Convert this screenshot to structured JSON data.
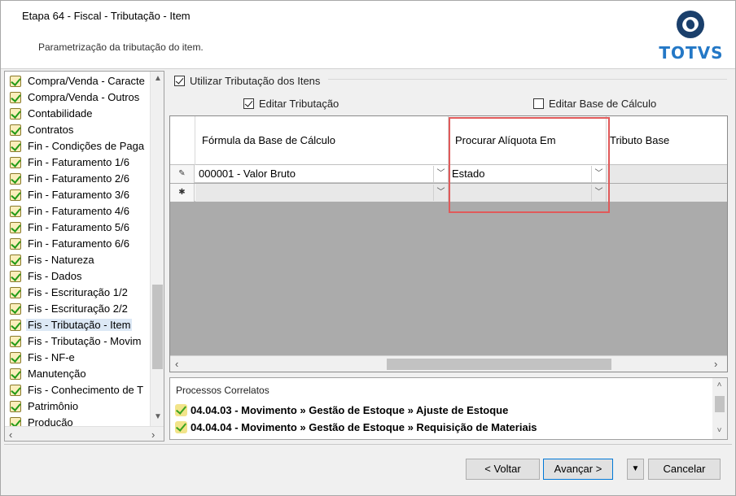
{
  "header": {
    "title": "Etapa 64 - Fiscal - Tributação - Item",
    "subtitle": "Parametrização da tributação do item.",
    "logo_text": "TOTVS"
  },
  "tree": {
    "items": [
      {
        "label": "Compra/Venda - Caracte",
        "selected": false
      },
      {
        "label": "Compra/Venda - Outros",
        "selected": false
      },
      {
        "label": "Contabilidade",
        "selected": false
      },
      {
        "label": "Contratos",
        "selected": false
      },
      {
        "label": "Fin - Condições de Paga",
        "selected": false
      },
      {
        "label": "Fin - Faturamento 1/6",
        "selected": false
      },
      {
        "label": "Fin - Faturamento 2/6",
        "selected": false
      },
      {
        "label": "Fin - Faturamento 3/6",
        "selected": false
      },
      {
        "label": "Fin - Faturamento 4/6",
        "selected": false
      },
      {
        "label": "Fin - Faturamento 5/6",
        "selected": false
      },
      {
        "label": "Fin - Faturamento 6/6",
        "selected": false
      },
      {
        "label": "Fis - Natureza",
        "selected": false
      },
      {
        "label": "Fis - Dados",
        "selected": false
      },
      {
        "label": "Fis - Escrituração 1/2",
        "selected": false
      },
      {
        "label": "Fis - Escrituração 2/2",
        "selected": false
      },
      {
        "label": "Fis - Tributação - Item",
        "selected": true
      },
      {
        "label": "Fis - Tributação - Movim",
        "selected": false
      },
      {
        "label": "Fis - NF-e",
        "selected": false
      },
      {
        "label": "Manutenção",
        "selected": false
      },
      {
        "label": "Fis - Conhecimento de T",
        "selected": false
      },
      {
        "label": "Patrimônio",
        "selected": false
      },
      {
        "label": "Produção",
        "selected": false
      }
    ]
  },
  "options": {
    "use_item_taxation": {
      "label": "Utilizar Tributação dos Itens",
      "checked": true
    },
    "edit_taxation": {
      "label": "Editar Tributação",
      "checked": true
    },
    "edit_calc_base": {
      "label": "Editar Base de Cálculo",
      "checked": false
    }
  },
  "grid": {
    "columns": [
      "Fórmula da Base de Cálculo",
      "Procurar Alíquota Em",
      "Tributo Base"
    ],
    "rows": [
      {
        "marker": "✎",
        "formula": "000001 - Valor Bruto",
        "aliquota": "Estado",
        "tributo": ""
      },
      {
        "marker": "✱",
        "formula": "",
        "aliquota": "",
        "tributo": ""
      }
    ]
  },
  "related": {
    "title": "Processos Correlatos",
    "items": [
      "04.04.03 - Movimento » Gestão de Estoque » Ajuste de Estoque",
      "04.04.04 - Movimento » Gestão de Estoque » Requisição de Materiais"
    ]
  },
  "buttons": {
    "back": "< Voltar",
    "next": "Avançar >",
    "dropdown": "▼",
    "cancel": "Cancelar"
  }
}
